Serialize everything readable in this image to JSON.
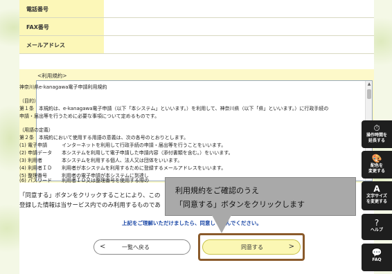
{
  "form": {
    "phone_label": "電話番号",
    "fax_label": "FAX番号",
    "email_label": "メールアドレス"
  },
  "terms": {
    "heading": "<利用規約>",
    "lines": [
      "神奈川県e-kanagawa電子申請利用規約",
      "",
      "（目的）",
      "第１条　本規約は、e-kanagawa電子申請（以下「本システム」といいます。）を利用して、神奈川県（以下「県」といいます。）に行政手続の",
      "申請・届出等を行うために必要な事項について定めるものです。",
      "",
      "（用語の定義）",
      "第２条　本規約において使用する用語の意義は、次の各号のとおりとします。",
      "(1) 電子申請　　　インターネットを利用して行政手続の申請・届出等を行うことをいいます。",
      "(2) 申請データ　　本システムを利用して電子申請した申請内容（添付書類を含む。）をいいます。",
      "(3) 利用者　　　　本システムを利用する個人、法人又は団体をいいます。",
      "(4) 利用者ＩＤ　　利用者が本システムを利用するために登録するメールアドレスをいいます。",
      "(5) 整理番号　　　利用者の電子申請が本システムに到達し",
      "(6) パスワード　　利用者ＩＤ又は整理番号を使用する際の"
    ]
  },
  "consent": {
    "line1": "「同意する」ボタンをクリックすることにより、この",
    "line2": "登録した情報は当サービス内でのみ利用するものであ"
  },
  "notice": "上記をご理解いただけましたら、同意して進んでください。",
  "buttons": {
    "back_label": "一覧へ戻る",
    "back_arrow": "<",
    "agree_label": "同意する",
    "agree_arrow": ">"
  },
  "callout": {
    "line1": "利用規約をご確認のうえ",
    "line2": "「同意する」ボタンをクリックします"
  },
  "sidebar": {
    "items": [
      {
        "icon": "⏱",
        "label1": "操作時間を",
        "label2": "延長する"
      },
      {
        "icon": "🎨",
        "label1": "配色を",
        "label2": "変更する"
      },
      {
        "icon": "A",
        "label1": "文字サイズ",
        "label2": "を変更する"
      },
      {
        "icon": "?",
        "label1": "ヘルプ",
        "label2": ""
      },
      {
        "icon": "💬",
        "label1": "FAQ",
        "label2": ""
      }
    ]
  }
}
